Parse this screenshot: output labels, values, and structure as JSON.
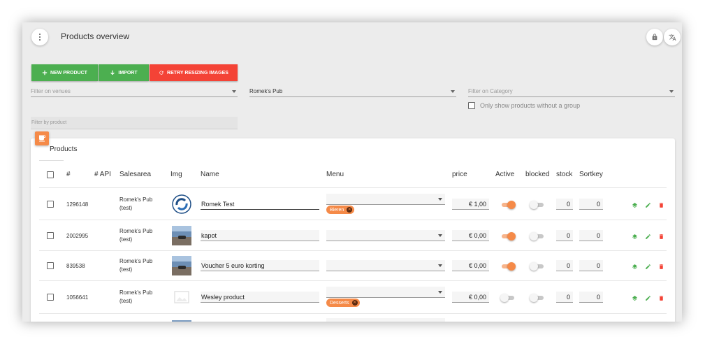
{
  "header": {
    "title": "Products overview"
  },
  "buttons": {
    "new_product": "NEW PRODUCT",
    "import": "IMPORT",
    "retry": "RETRY RESIZING IMAGES"
  },
  "filters": {
    "venues_placeholder": "Filter on venues",
    "venue_selected": "Romek's Pub",
    "category_placeholder": "Filter on Category",
    "only_without_group_label": "Only show products without a group",
    "product_placeholder": "Filter by product"
  },
  "card": {
    "title": "Products"
  },
  "table": {
    "headers": {
      "id": "#",
      "api": "# API",
      "salesarea": "Salesarea",
      "img": "Img",
      "name": "Name",
      "menu": "Menu",
      "price": "price",
      "active": "Active",
      "blocked": "blocked",
      "stock": "stock",
      "sortkey": "Sortkey"
    },
    "rows": [
      {
        "id": "1296148",
        "sales1": "Romek's Pub",
        "sales2": "(test)",
        "name": "Romek Test",
        "menu_chip": "Bieren",
        "price": "€ 1,00",
        "active": true,
        "blocked": false,
        "stock": "0",
        "sortkey": "0",
        "img": "logo"
      },
      {
        "id": "2002995",
        "sales1": "Romek's Pub",
        "sales2": "(test)",
        "name": "kapot",
        "menu_chip": "",
        "price": "€ 0,00",
        "active": true,
        "blocked": false,
        "stock": "0",
        "sortkey": "0",
        "img": "photo"
      },
      {
        "id": "839538",
        "sales1": "Romek's Pub",
        "sales2": "(test)",
        "name": "Voucher 5 euro korting",
        "menu_chip": "",
        "price": "€ 0,00",
        "active": true,
        "blocked": false,
        "stock": "0",
        "sortkey": "0",
        "img": "photo"
      },
      {
        "id": "1056641",
        "sales1": "Romek's Pub",
        "sales2": "(test)",
        "name": "Wesley product",
        "menu_chip": "Desserts",
        "price": "€ 0,00",
        "active": false,
        "blocked": false,
        "stock": "0",
        "sortkey": "0",
        "img": "placeholder"
      }
    ]
  },
  "colors": {
    "accent": "#f58a48",
    "green": "#4caf50",
    "red": "#f44336"
  },
  "icons": [
    "kebab-menu-icon",
    "lock-icon",
    "translate-icon",
    "plus-icon",
    "download-icon",
    "refresh-icon",
    "coffee-cup-icon",
    "layers-icon",
    "pencil-icon",
    "trash-icon"
  ]
}
